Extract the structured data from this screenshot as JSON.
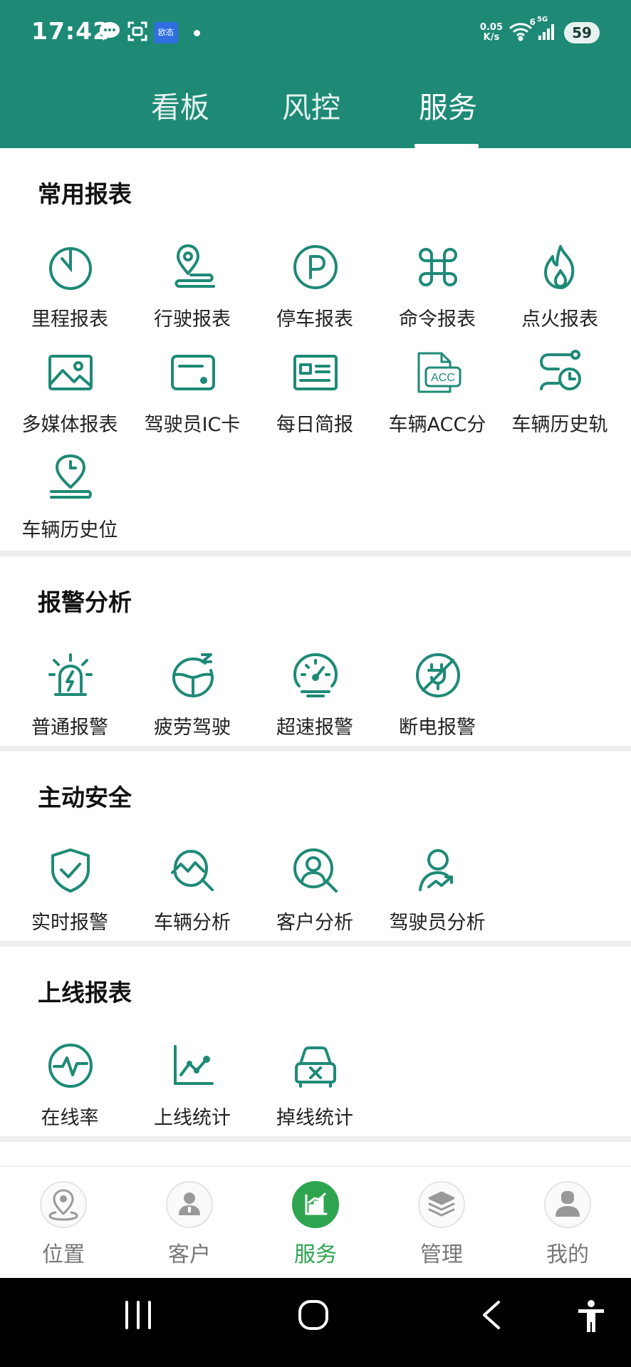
{
  "status_bar": {
    "time": "17:42",
    "app_badge": "欧态",
    "net_speed_value": "0.05",
    "net_speed_unit": "K/s",
    "signal_label": "6",
    "network_type": "5G",
    "battery": "59"
  },
  "top_tabs": [
    {
      "label": "看板",
      "active": false
    },
    {
      "label": "风控",
      "active": false
    },
    {
      "label": "服务",
      "active": true
    }
  ],
  "sections": {
    "common_reports": {
      "title": "常用报表",
      "items": [
        {
          "label": "里程报表",
          "icon": "timer-icon"
        },
        {
          "label": "行驶报表",
          "icon": "route-pin-icon"
        },
        {
          "label": "停车报表",
          "icon": "parking-icon"
        },
        {
          "label": "命令报表",
          "icon": "command-icon"
        },
        {
          "label": "点火报表",
          "icon": "flame-icon"
        },
        {
          "label": "多媒体报表",
          "icon": "image-icon"
        },
        {
          "label": "驾驶员IC卡",
          "icon": "ic-card-icon"
        },
        {
          "label": "每日简报",
          "icon": "id-card-icon"
        },
        {
          "label": "车辆ACC分",
          "icon": "acc-icon"
        },
        {
          "label": "车辆历史轨",
          "icon": "track-clock-icon"
        },
        {
          "label": "车辆历史位",
          "icon": "location-clock-icon"
        }
      ]
    },
    "alarm_analysis": {
      "title": "报警分析",
      "items": [
        {
          "label": "普通报警",
          "icon": "siren-icon"
        },
        {
          "label": "疲劳驾驶",
          "icon": "steering-wheel-icon"
        },
        {
          "label": "超速报警",
          "icon": "speedometer-icon"
        },
        {
          "label": "断电报警",
          "icon": "power-off-icon"
        }
      ]
    },
    "active_safety": {
      "title": "主动安全",
      "items": [
        {
          "label": "实时报警",
          "icon": "shield-check-icon"
        },
        {
          "label": "车辆分析",
          "icon": "chart-search-icon"
        },
        {
          "label": "客户分析",
          "icon": "user-search-icon"
        },
        {
          "label": "驾驶员分析",
          "icon": "user-trend-icon"
        }
      ]
    },
    "online_reports": {
      "title": "上线报表",
      "items": [
        {
          "label": "在线率",
          "icon": "pulse-icon"
        },
        {
          "label": "上线统计",
          "icon": "line-chart-icon"
        },
        {
          "label": "掉线统计",
          "icon": "car-x-icon"
        }
      ]
    }
  },
  "bottom_nav": [
    {
      "label": "位置",
      "icon": "location-icon",
      "active": false
    },
    {
      "label": "客户",
      "icon": "person-icon",
      "active": false
    },
    {
      "label": "服务",
      "icon": "bar-chart-icon",
      "active": true
    },
    {
      "label": "管理",
      "icon": "layers-icon",
      "active": false
    },
    {
      "label": "我的",
      "icon": "profile-icon",
      "active": false
    }
  ],
  "colors": {
    "primary": "#1e8a76",
    "accent_green": "#2ea44f",
    "icon_green": "#1e8a76"
  }
}
